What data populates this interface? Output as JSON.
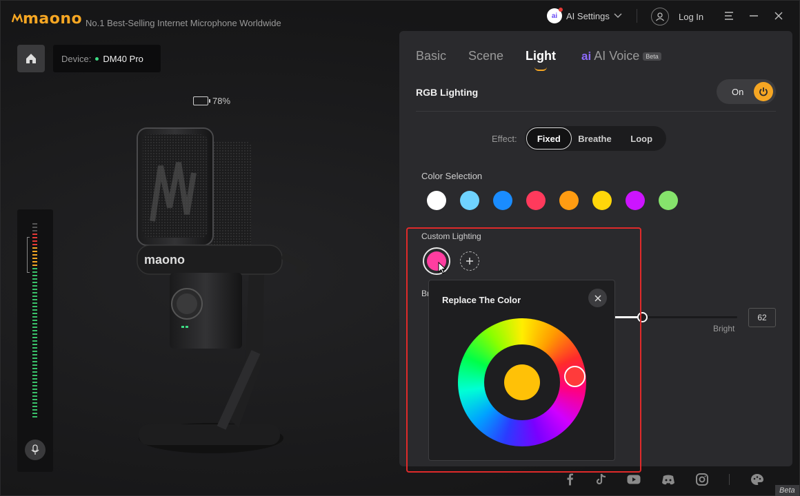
{
  "app": {
    "logo": "maono",
    "tagline": "No.1 Best-Selling Internet Microphone Worldwide"
  },
  "titlebar": {
    "ai_settings_label": "AI Settings",
    "login_label": "Log In"
  },
  "device": {
    "label": "Device:",
    "name": "DM40 Pro",
    "battery": "78%",
    "battery_level": 0.78,
    "mic_brand": "maono"
  },
  "tabs": [
    {
      "label": "Basic"
    },
    {
      "label": "Scene"
    },
    {
      "label": "Light",
      "active": true
    },
    {
      "label": "AI Voice",
      "badge": "Beta"
    }
  ],
  "rgb": {
    "title": "RGB Lighting",
    "toggle_label": "On",
    "effect_label": "Effect:",
    "effects": [
      "Fixed",
      "Breathe",
      "Loop"
    ],
    "active_effect": "Fixed",
    "color_selection_label": "Color Selection",
    "colors": [
      "#ffffff",
      "#6fd3ff",
      "#1a8cff",
      "#ff3a5c",
      "#ff9c12",
      "#ffd60a",
      "#cc14ff",
      "#86e36c"
    ],
    "custom_label": "Custom Lighting",
    "custom_color": "#ff3da0",
    "brightness_label": "Br",
    "brightness_value": "62",
    "brightness_word": "Bright"
  },
  "popup": {
    "title": "Replace The Color",
    "preview_color": "#ffc107"
  },
  "footer": {
    "beta": "Beta"
  },
  "theme": {
    "accent": "#f5a623",
    "highlight": "#e02a2a"
  }
}
